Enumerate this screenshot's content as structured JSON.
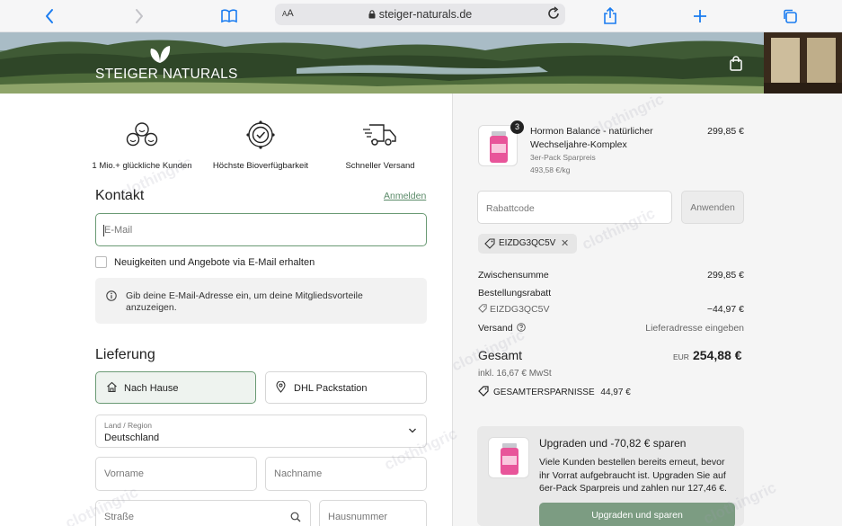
{
  "browser": {
    "text_size_label_small": "A",
    "text_size_label_large": "A",
    "url": "steiger-naturals.de"
  },
  "brand": {
    "name": "STEIGER NATURALS"
  },
  "features": [
    {
      "label": "1 Mio.+ glückliche Kunden",
      "icon": "happy-faces-icon"
    },
    {
      "label": "Höchste Bioverfügbarkeit",
      "icon": "check-badge-icon"
    },
    {
      "label": "Schneller Versand",
      "icon": "delivery-truck-icon"
    }
  ],
  "contact": {
    "title": "Kontakt",
    "login_link": "Anmelden",
    "email_placeholder": "E-Mail",
    "newsletter_label": "Neuigkeiten und Angebote via E-Mail erhalten",
    "info_text": "Gib deine E-Mail-Adresse ein, um deine Mitgliedsvorteile anzuzeigen."
  },
  "delivery": {
    "title": "Lieferung",
    "options": [
      {
        "label": "Nach Hause",
        "active": true,
        "icon": "home-icon"
      },
      {
        "label": "DHL Packstation",
        "active": false,
        "icon": "location-pin-icon"
      }
    ],
    "country_label": "Land / Region",
    "country_value": "Deutschland",
    "first_name_placeholder": "Vorname",
    "last_name_placeholder": "Nachname",
    "street_placeholder": "Straße",
    "house_number_placeholder": "Hausnummer"
  },
  "order": {
    "item": {
      "quantity": "3",
      "name": "Hormon Balance - natürlicher Wechseljahre-Komplex",
      "variant": "3er-Pack Sparpreis",
      "unit_price": "493,58 €/kg",
      "price": "299,85 €"
    },
    "discount_placeholder": "Rabattcode",
    "apply_label": "Anwenden",
    "applied_code": "EIZDG3QC5V",
    "subtotal_label": "Zwischensumme",
    "subtotal_value": "299,85 €",
    "order_discount_label": "Bestellungsrabatt",
    "order_discount_code": "EIZDG3QC5V",
    "order_discount_value": "−44,97 €",
    "shipping_label": "Versand",
    "shipping_value": "Lieferadresse eingeben",
    "total_label": "Gesamt",
    "total_currency": "EUR",
    "total_value": "254,88 €",
    "tax_text": "inkl. 16,67 € MwSt",
    "savings_label": "GESAMTERSPARNISSE",
    "savings_value": "44,97 €"
  },
  "upsell": {
    "title": "Upgraden und -70,82 € sparen",
    "text": "Viele Kunden bestellen bereits erneut, bevor ihr Vorrat aufgebraucht ist. Upgraden Sie auf 6er-Pack Sparpreis und zahlen nur 127,46 €.",
    "button_label": "Upgraden und sparen"
  },
  "watermark": "clothingric",
  "colors": {
    "accent_green": "#6a9a74",
    "button_green": "#7c9c82",
    "link_green": "#5a8a68",
    "safari_blue": "#1a7cf0"
  }
}
